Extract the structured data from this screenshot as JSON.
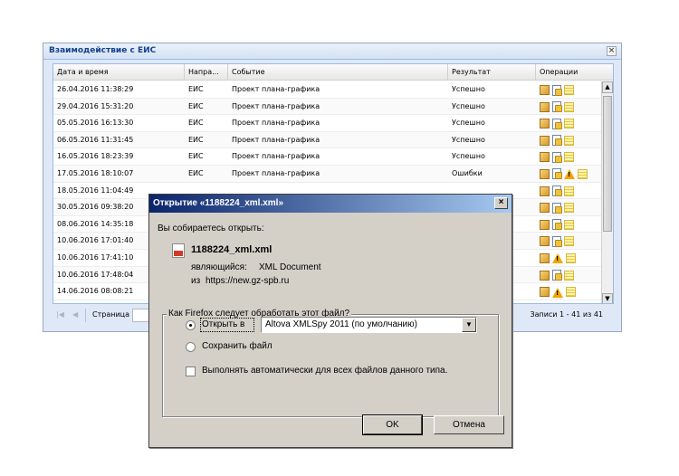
{
  "window": {
    "title": "Взаимодействие с ЕИС",
    "close": "×"
  },
  "grid": {
    "columns": [
      "Дата и время",
      "Напра...",
      "Событие",
      "Результат",
      "Операции"
    ],
    "rows": [
      {
        "date": "26.04.2016 11:38:29",
        "dir": "ЕИС",
        "event": "Проект плана-графика",
        "result": "Успешно",
        "ops": [
          "box-icon",
          "doc-icon",
          "note-icon"
        ]
      },
      {
        "date": "29.04.2016 15:31:20",
        "dir": "ЕИС",
        "event": "Проект плана-графика",
        "result": "Успешно",
        "ops": [
          "box-icon",
          "doc-icon",
          "note-icon"
        ]
      },
      {
        "date": "05.05.2016 16:13:30",
        "dir": "ЕИС",
        "event": "Проект плана-графика",
        "result": "Успешно",
        "ops": [
          "box-icon",
          "doc-icon",
          "note-icon"
        ]
      },
      {
        "date": "06.05.2016 11:31:45",
        "dir": "ЕИС",
        "event": "Проект плана-графика",
        "result": "Успешно",
        "ops": [
          "box-icon",
          "doc-icon",
          "note-icon"
        ]
      },
      {
        "date": "16.05.2016 18:23:39",
        "dir": "ЕИС",
        "event": "Проект плана-графика",
        "result": "Успешно",
        "ops": [
          "box-icon",
          "doc-icon",
          "note-icon"
        ]
      },
      {
        "date": "17.05.2016 18:10:07",
        "dir": "ЕИС",
        "event": "Проект плана-графика",
        "result": "Ошибки",
        "ops": [
          "box-icon",
          "doc-icon",
          "warning-icon",
          "note-icon"
        ]
      },
      {
        "date": "18.05.2016 11:04:49",
        "dir": "",
        "event": "",
        "result": "",
        "ops": [
          "box-icon",
          "doc-icon",
          "note-icon"
        ]
      },
      {
        "date": "30.05.2016 09:38:20",
        "dir": "",
        "event": "",
        "result": "",
        "ops": [
          "box-icon",
          "doc-icon",
          "note-icon"
        ]
      },
      {
        "date": "08.06.2016 14:35:18",
        "dir": "",
        "event": "",
        "result": "",
        "ops": [
          "box-icon",
          "doc-icon",
          "note-icon"
        ]
      },
      {
        "date": "10.06.2016 17:01:40",
        "dir": "",
        "event": "",
        "result": "",
        "ops": [
          "box-icon",
          "doc-icon",
          "note-icon"
        ]
      },
      {
        "date": "10.06.2016 17:41:10",
        "dir": "",
        "event": "",
        "result": "",
        "ops": [
          "box-icon",
          "warning-icon",
          "note-icon"
        ]
      },
      {
        "date": "10.06.2016 17:48:04",
        "dir": "",
        "event": "",
        "result": "",
        "ops": [
          "box-icon",
          "doc-icon",
          "note-icon"
        ]
      },
      {
        "date": "14.06.2016 08:08:21",
        "dir": "",
        "event": "",
        "result": "",
        "ops": [
          "box-icon",
          "warning-icon",
          "note-icon"
        ]
      }
    ]
  },
  "pager": {
    "page_label": "Страница",
    "records": "Записи 1 - 41 из 41"
  },
  "dialog": {
    "title": "Открытие «1188224_xml.xml»",
    "close": "×",
    "intro": "Вы собираетесь открыть:",
    "filename": "1188224_xml.xml",
    "type_label": "являющийся:",
    "type_value": "XML Document",
    "from_label": "из",
    "from_value": "https://new.gz-spb.ru",
    "group_legend": "Как Firefox следует обработать этот файл?",
    "open_label": "Открыть в",
    "open_selected": true,
    "app_value": "Altova XMLSpy 2011 (по умолчанию)",
    "save_label": "Сохранить файл",
    "auto_label": "Выполнять автоматически для всех файлов данного типа.",
    "auto_checked": false,
    "ok_label": "OK",
    "cancel_label": "Отмена"
  }
}
